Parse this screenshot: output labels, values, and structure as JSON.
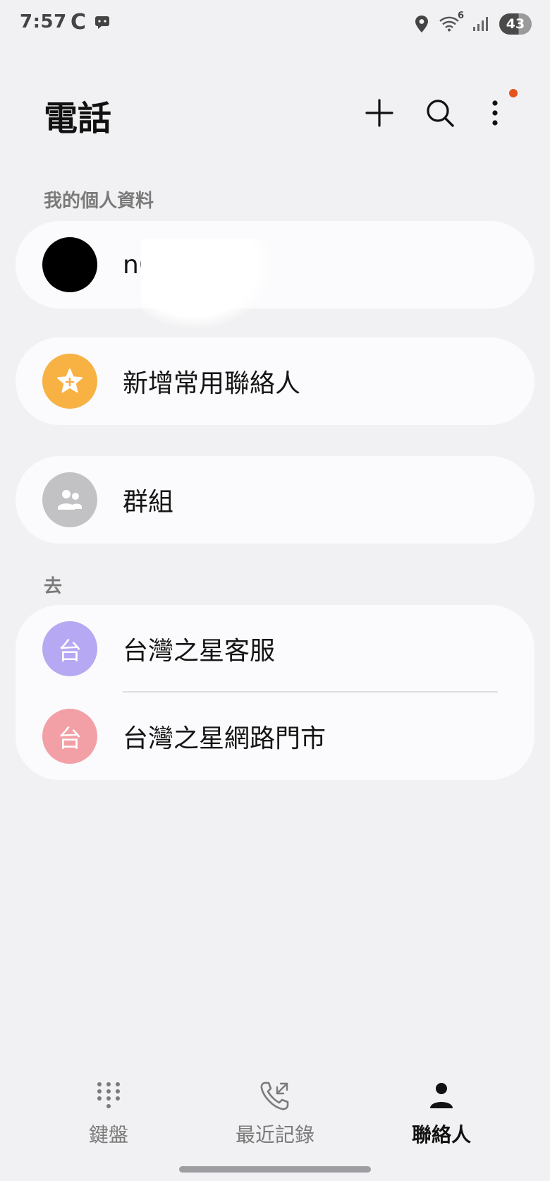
{
  "status_bar": {
    "time": "7:57",
    "app_letter": "C",
    "network": "6",
    "battery": "43"
  },
  "header": {
    "title": "電話",
    "add_icon": "plus-icon",
    "search_icon": "search-icon",
    "more_icon": "more-vertical-icon",
    "notification_dot_color": "#e5541c"
  },
  "profile_section": {
    "label": "我的個人資料",
    "name": "n6",
    "avatar_color": "#000000"
  },
  "favorites": {
    "label": "新增常用聯絡人",
    "icon": "star-plus-icon",
    "avatar_color": "#f8b143"
  },
  "groups": {
    "label": "群組",
    "icon": "group-icon",
    "avatar_color": "#c2c2c4"
  },
  "contacts_section": {
    "label": "去",
    "items": [
      {
        "name": "台灣之星客服",
        "initial": "台",
        "color": "#b6a8f2"
      },
      {
        "name": "台灣之星網路門市",
        "initial": "台",
        "color": "#f2a0a6"
      }
    ]
  },
  "bottom_nav": {
    "items": [
      {
        "label": "鍵盤",
        "icon": "keypad-icon"
      },
      {
        "label": "最近記錄",
        "icon": "recent-calls-icon"
      },
      {
        "label": "聯絡人",
        "icon": "contacts-person-icon"
      }
    ],
    "active_index": 2
  }
}
